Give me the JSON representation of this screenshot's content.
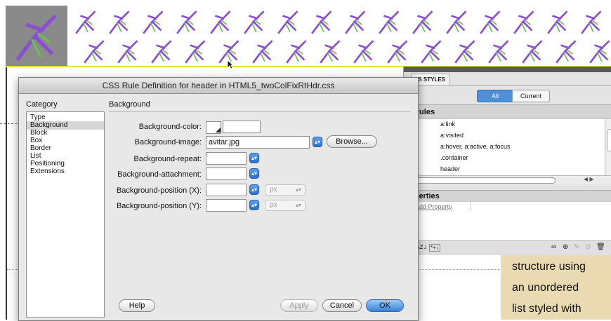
{
  "page": {
    "side_text": [
      "structure using",
      "an unordered",
      "list styled with"
    ]
  },
  "css_panel": {
    "tab_label": "SS STYLES",
    "seg_all": "All",
    "seg_current": "Current",
    "rules_header": "l Rules",
    "rules": [
      "a:link",
      "a:visited",
      "a:hover, a:active, a:focus",
      ".container",
      "header"
    ],
    "props_header": "operties",
    "add_property": "Add Property",
    "footer_left_icons": [
      "≡",
      "Az↓",
      "*+↓"
    ],
    "footer_right_icons": [
      "∞",
      "⊕",
      "✎",
      "⊘",
      "🗑"
    ]
  },
  "dialog": {
    "title": "CSS Rule Definition for header in HTML5_twoColFixRtHdr.css",
    "category_label": "Category",
    "categories": [
      "Type",
      "Background",
      "Block",
      "Box",
      "Border",
      "List",
      "Positioning",
      "Extensions"
    ],
    "selected_category": "Background",
    "section_label": "Background",
    "fields": {
      "bg_color_label": "Background-color:",
      "bg_color_value": "",
      "bg_image_label": "Background-image:",
      "bg_image_value": "avitar.jpg",
      "bg_repeat_label": "Background-repeat:",
      "bg_repeat_value": "",
      "bg_attachment_label": "Background-attachment:",
      "bg_attachment_value": "",
      "bg_pos_x_label": "Background-position (X):",
      "bg_pos_x_value": "",
      "bg_pos_y_label": "Background-position (Y):",
      "bg_pos_y_value": "",
      "unit_x": "px",
      "unit_y": "px"
    },
    "browse_button": "Browse...",
    "help_button": "Help",
    "apply_button": "Apply",
    "cancel_button": "Cancel",
    "ok_button": "OK"
  },
  "colors": {
    "banner_border": "#e9e12a",
    "side_box": "#e9dab2",
    "accent_blue": "#3a84d6",
    "figure_purple": "#8a4fd0",
    "figure_green": "#6bbd5a"
  }
}
